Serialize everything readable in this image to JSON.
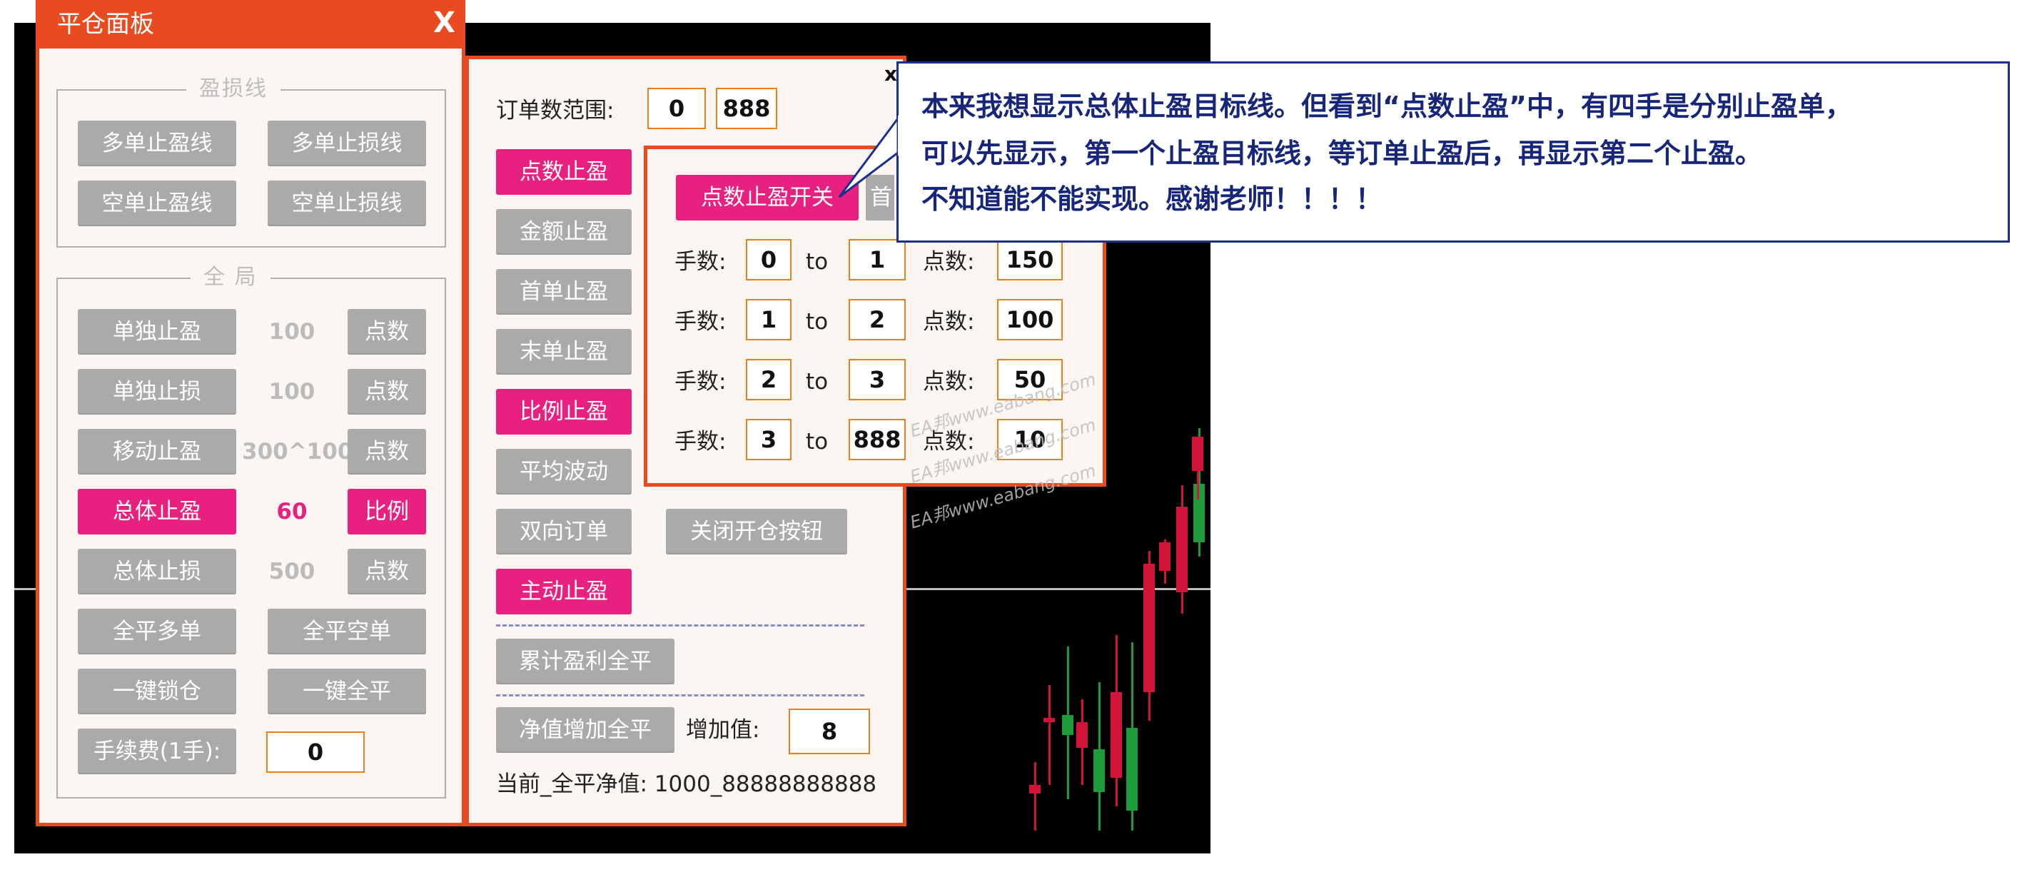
{
  "panel1": {
    "title": "平仓面板",
    "close_label": "X",
    "group1_label": "盈损线",
    "group1_buttons": [
      "多单止盈线",
      "多单止损线",
      "空单止盈线",
      "空单止损线"
    ],
    "group2_label": "全 局",
    "rows": [
      {
        "label": "单独止盈",
        "value": "100",
        "unit": "点数",
        "active": false
      },
      {
        "label": "单独止损",
        "value": "100",
        "unit": "点数",
        "active": false
      },
      {
        "label": "移动止盈",
        "value": "300^100",
        "unit": "点数",
        "active": false
      },
      {
        "label": "总体止盈",
        "value": "60",
        "unit": "比例",
        "active": true
      },
      {
        "label": "总体止损",
        "value": "500",
        "unit": "点数",
        "active": false
      }
    ],
    "close_long": "全平多单",
    "close_short": "全平空单",
    "lock": "一键锁仓",
    "close_all": "一键全平",
    "fee_label": "手续费(1手):",
    "fee_value": "0"
  },
  "panel2": {
    "close_label": "x",
    "order_range_label": "订单数范围:",
    "order_range_from": "0",
    "order_range_to": "888",
    "side_buttons": [
      {
        "label": "点数止盈",
        "active": true
      },
      {
        "label": "金额止盈",
        "active": false
      },
      {
        "label": "首单止盈",
        "active": false
      },
      {
        "label": "末单止盈",
        "active": false
      },
      {
        "label": "比例止盈",
        "active": true
      },
      {
        "label": "平均波动",
        "active": false
      },
      {
        "label": "双向订单",
        "active": false
      },
      {
        "label": "主动止盈",
        "active": true
      }
    ],
    "close_open_button": "关闭开仓按钮",
    "cum_profit_button": "累计盈利全平",
    "equity_button": "净值增加全平",
    "increase_label": "增加值:",
    "increase_value": "8",
    "current_label": "当前_全平净值: 1000_88888888888"
  },
  "panel3": {
    "switch_button": "点数止盈开关",
    "hidden_button_fragment": "首",
    "lots_label": "手数:",
    "to_label": "to",
    "points_label": "点数:",
    "rows": [
      {
        "from": "0",
        "to": "1",
        "points": "150"
      },
      {
        "from": "1",
        "to": "2",
        "points": "100"
      },
      {
        "from": "2",
        "to": "3",
        "points": "50"
      },
      {
        "from": "3",
        "to": "888",
        "points": "10"
      }
    ]
  },
  "watermark": "EA邦www.eabang.com",
  "callout": {
    "lines": [
      "本来我想显示总体止盈目标线。但看到“点数止盈”中，有四手是分别止盈单，",
      "可以先显示，第一个止盈目标线，等订单止盈后，再显示第二个止盈。",
      "不知道能不能实现。感谢老师！！！！"
    ]
  },
  "colors": {
    "accent": "#e84b1f",
    "active": "#e8207f",
    "inactive": "#aaaaaa",
    "field_border": "#e9801c",
    "callout_text": "#18267a",
    "candle_up": "#1f9a3a",
    "candle_down": "#d2143a"
  }
}
